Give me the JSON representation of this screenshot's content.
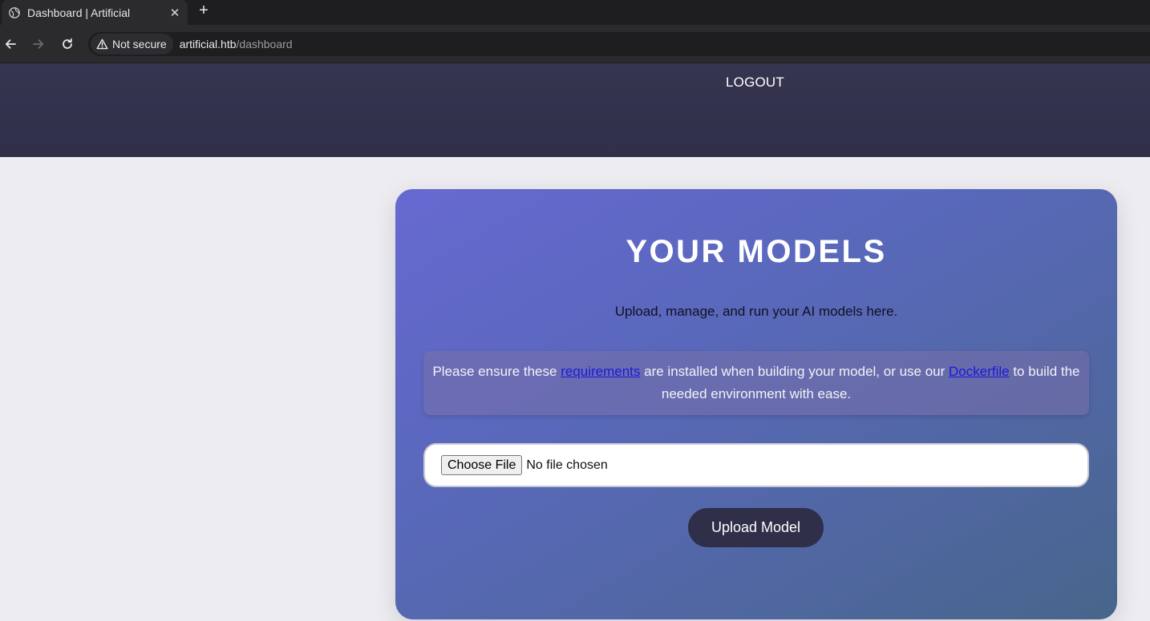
{
  "browser": {
    "tab_title": "Dashboard | Artificial",
    "close_glyph": "✕",
    "new_tab_glyph": "+",
    "security_label": "Not secure",
    "url_host": "artificial.htb",
    "url_path": "/dashboard"
  },
  "header": {
    "logout_label": "LOGOUT"
  },
  "main": {
    "title": "YOUR MODELS",
    "subtitle": "Upload, manage, and run your AI models here.",
    "notice": {
      "text_before": "Please ensure these ",
      "requirements_link": "requirements",
      "text_middle": " are installed when building your model, or use our ",
      "dockerfile_link": "Dockerfile",
      "text_after": " to build the needed environment with ease."
    },
    "file_input": {
      "button_label": "Choose File",
      "status": "No file chosen"
    },
    "upload_button": "Upload Model"
  },
  "colors": {
    "header_bg": "#33334f",
    "card_gradient_start": "#6769d1",
    "card_gradient_end": "#47658b",
    "upload_button_bg": "#2f2f4a",
    "link": "#1a1ad8"
  },
  "icons": {
    "tab_favicon": "globe-icon",
    "back": "arrow-left-icon",
    "forward": "arrow-right-icon",
    "reload": "reload-icon",
    "security": "warning-triangle-icon"
  }
}
